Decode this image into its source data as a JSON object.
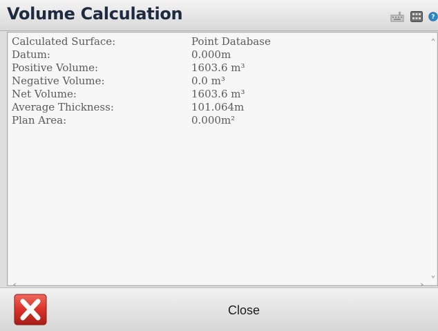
{
  "window": {
    "title": "Volume Calculation"
  },
  "toolbar": {
    "icons": [
      "keyboard-icon",
      "grid-icon",
      "help-icon"
    ]
  },
  "results": {
    "rows": [
      {
        "label": "Calculated Surface:",
        "value": "Point Database"
      },
      {
        "label": "Datum:",
        "value": "0.000m"
      },
      {
        "label": "Positive Volume:",
        "value": "1603.6 m³"
      },
      {
        "label": "Negative Volume:",
        "value": "0.0 m³"
      },
      {
        "label": "Net Volume:",
        "value": "1603.6 m³"
      },
      {
        "label": "Average Thickness:",
        "value": "101.064m"
      },
      {
        "label": "Plan Area:",
        "value": "0.000m²"
      }
    ]
  },
  "footer": {
    "close_label": "Close"
  },
  "colors": {
    "title_text": "#1d2a3f",
    "close_button_red": "#d8322a",
    "help_blue": "#2a86c8"
  }
}
